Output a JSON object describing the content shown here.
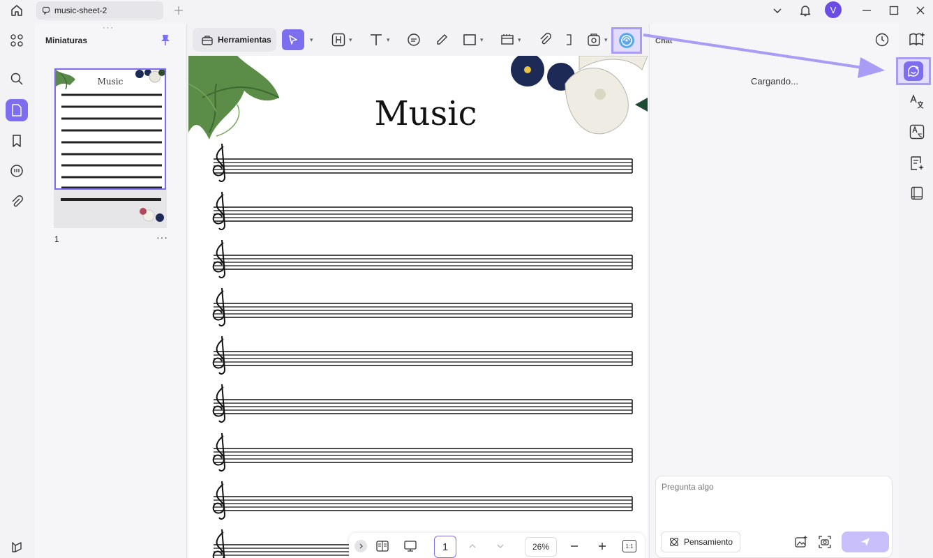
{
  "window": {
    "tab_title": "music-sheet-2",
    "avatar_letter": "V"
  },
  "thumbnails": {
    "title": "Miniaturas",
    "page_number": "1",
    "more": "···",
    "thumb_title": "Music"
  },
  "toolbar": {
    "tools_label": "Herramientas"
  },
  "document": {
    "title": "Music",
    "staff_count": 9
  },
  "bottom_bar": {
    "current_page": "1",
    "zoom": "26%",
    "fit_label": "1:1"
  },
  "chat": {
    "title": "Chat",
    "status": "Cargando...",
    "input_placeholder": "Pregunta algo",
    "thinking_label": "Pensamiento"
  },
  "colors": {
    "accent": "#7d6ef0",
    "highlight": "#a99cf5"
  }
}
